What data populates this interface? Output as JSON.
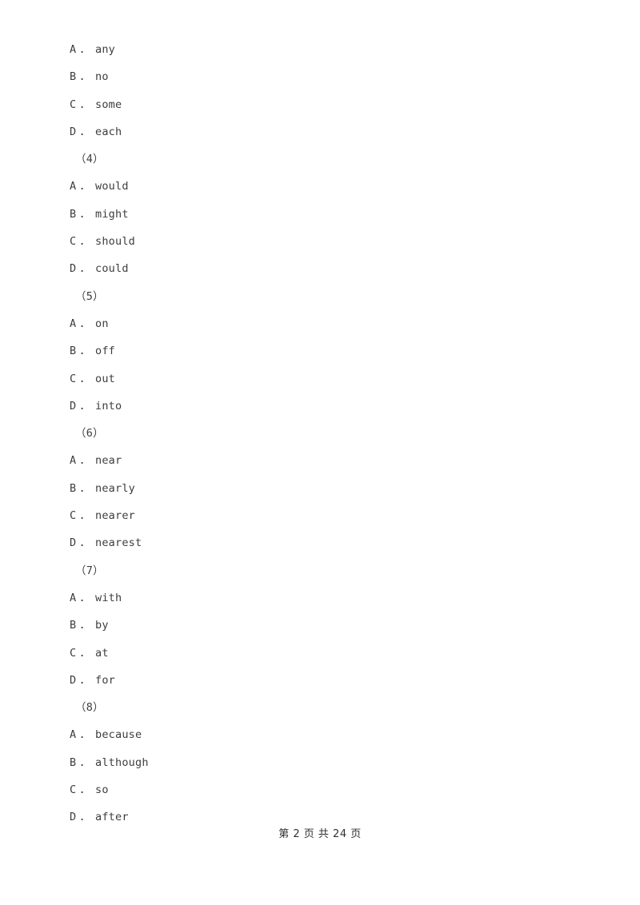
{
  "document": {
    "page_background": "#ffffff",
    "text_color": "#3d3d3d"
  },
  "blocks": [
    {
      "kind": "option",
      "letter": "A",
      "dot": "．",
      "text": "any"
    },
    {
      "kind": "option",
      "letter": "B",
      "dot": "．",
      "text": "no"
    },
    {
      "kind": "option",
      "letter": "C",
      "dot": "．",
      "text": "some"
    },
    {
      "kind": "option",
      "letter": "D",
      "dot": "．",
      "text": "each"
    },
    {
      "kind": "question",
      "label": "（4）"
    },
    {
      "kind": "option",
      "letter": "A",
      "dot": "．",
      "text": "would"
    },
    {
      "kind": "option",
      "letter": "B",
      "dot": "．",
      "text": "might"
    },
    {
      "kind": "option",
      "letter": "C",
      "dot": "．",
      "text": "should"
    },
    {
      "kind": "option",
      "letter": "D",
      "dot": "．",
      "text": "could"
    },
    {
      "kind": "question",
      "label": "（5）"
    },
    {
      "kind": "option",
      "letter": "A",
      "dot": "．",
      "text": "on"
    },
    {
      "kind": "option",
      "letter": "B",
      "dot": "．",
      "text": "off"
    },
    {
      "kind": "option",
      "letter": "C",
      "dot": "．",
      "text": "out"
    },
    {
      "kind": "option",
      "letter": "D",
      "dot": "．",
      "text": "into"
    },
    {
      "kind": "question",
      "label": "（6）"
    },
    {
      "kind": "option",
      "letter": "A",
      "dot": "．",
      "text": "near"
    },
    {
      "kind": "option",
      "letter": "B",
      "dot": "．",
      "text": "nearly"
    },
    {
      "kind": "option",
      "letter": "C",
      "dot": "．",
      "text": "nearer"
    },
    {
      "kind": "option",
      "letter": "D",
      "dot": "．",
      "text": "nearest"
    },
    {
      "kind": "question",
      "label": "（7）"
    },
    {
      "kind": "option",
      "letter": "A",
      "dot": "．",
      "text": "with"
    },
    {
      "kind": "option",
      "letter": "B",
      "dot": "．",
      "text": "by"
    },
    {
      "kind": "option",
      "letter": "C",
      "dot": "．",
      "text": "at"
    },
    {
      "kind": "option",
      "letter": "D",
      "dot": "．",
      "text": "for"
    },
    {
      "kind": "question",
      "label": "（8）"
    },
    {
      "kind": "option",
      "letter": "A",
      "dot": "．",
      "text": "because"
    },
    {
      "kind": "option",
      "letter": "B",
      "dot": "．",
      "text": "although"
    },
    {
      "kind": "option",
      "letter": "C",
      "dot": "．",
      "text": "so"
    },
    {
      "kind": "option",
      "letter": "D",
      "dot": "．",
      "text": "after"
    }
  ],
  "footer": {
    "text": "第 2 页 共 24 页",
    "current_page": "2",
    "total_pages": "24"
  }
}
